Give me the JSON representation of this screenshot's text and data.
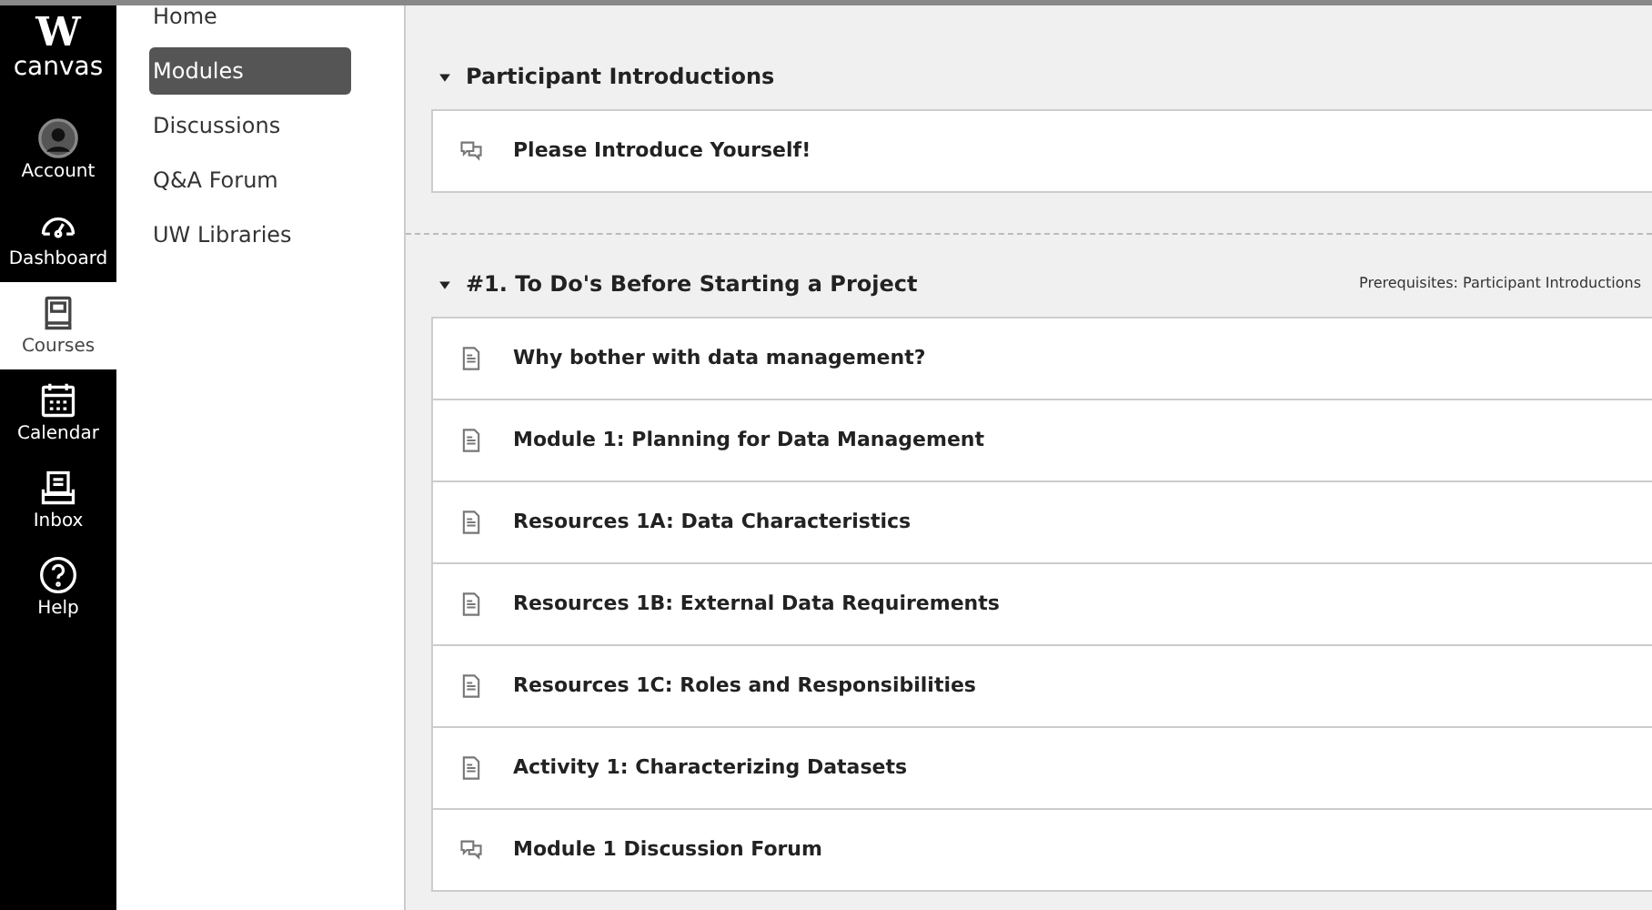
{
  "global_nav": {
    "logo": {
      "mark": "W",
      "text": "canvas"
    },
    "items": [
      {
        "kind": "account",
        "label": "Account",
        "selected": false
      },
      {
        "kind": "dashboard",
        "label": "Dashboard",
        "selected": false
      },
      {
        "kind": "courses",
        "label": "Courses",
        "selected": true
      },
      {
        "kind": "calendar",
        "label": "Calendar",
        "selected": false
      },
      {
        "kind": "inbox",
        "label": "Inbox",
        "selected": false
      },
      {
        "kind": "help",
        "label": "Help",
        "selected": false
      }
    ]
  },
  "course_nav": [
    {
      "label": "Home",
      "selected": false
    },
    {
      "label": "Modules",
      "selected": true
    },
    {
      "label": "Discussions",
      "selected": false
    },
    {
      "label": "Q&A Forum",
      "selected": false
    },
    {
      "label": "UW Libraries",
      "selected": false
    }
  ],
  "modules": [
    {
      "title": "Participant Introductions",
      "expanded": true,
      "items": [
        {
          "kind": "discussion",
          "title": "Please Introduce Yourself!"
        }
      ]
    },
    {
      "title": "#1. To Do's Before Starting a Project",
      "expanded": true,
      "prerequisites": "Prerequisites: Participant Introductions",
      "items": [
        {
          "kind": "page",
          "title": "Why bother with data management?"
        },
        {
          "kind": "page",
          "title": "Module 1: Planning for Data Management"
        },
        {
          "kind": "page",
          "title": "Resources 1A: Data Characteristics"
        },
        {
          "kind": "page",
          "title": "Resources 1B: External Data Requirements"
        },
        {
          "kind": "page",
          "title": "Resources 1C: Roles and Responsibilities"
        },
        {
          "kind": "page",
          "title": "Activity 1: Characterizing Datasets"
        },
        {
          "kind": "discussion",
          "title": "Module 1 Discussion Forum"
        }
      ]
    }
  ]
}
